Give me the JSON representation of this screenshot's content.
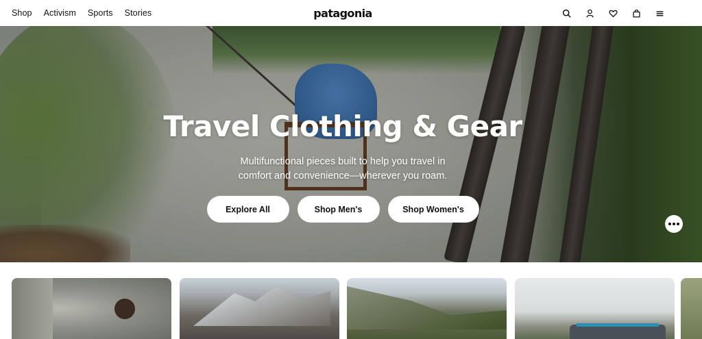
{
  "header": {
    "nav": [
      "Shop",
      "Activism",
      "Sports",
      "Stories"
    ],
    "logo_text": "patagonia",
    "icons": [
      "search-icon",
      "account-icon",
      "wishlist-icon",
      "cart-icon",
      "menu-icon"
    ]
  },
  "hero": {
    "title": "Travel Clothing & Gear",
    "subtitle_line1": "Multifunctional pieces built to help you travel in",
    "subtitle_line2": "comfort and convenience—wherever you roam.",
    "buttons": {
      "explore": "Explore All",
      "men": "Shop Men's",
      "women": "Shop Women's"
    }
  },
  "chat": {
    "icon": "more-dots-icon"
  },
  "colors": {
    "hero_text": "#ffffff",
    "button_bg": "#ffffff",
    "button_text": "#111111"
  }
}
